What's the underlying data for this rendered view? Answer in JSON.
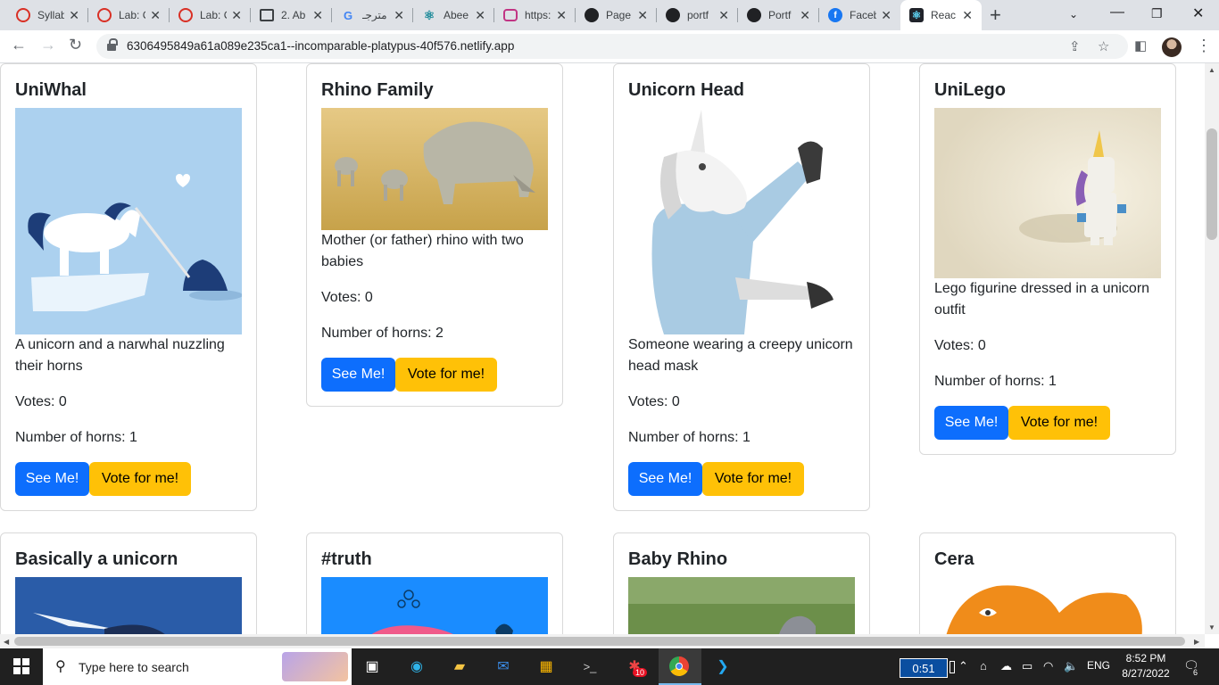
{
  "browser": {
    "tabs": [
      {
        "title": "Syllab",
        "icon": "red-ring-icon",
        "color": "#d93025"
      },
      {
        "title": "Lab: C",
        "icon": "red-ring-icon",
        "color": "#d93025"
      },
      {
        "title": "Lab: C",
        "icon": "red-ring-icon",
        "color": "#d93025"
      },
      {
        "title": "2. Ab",
        "icon": "book-icon",
        "color": "#3c4043"
      },
      {
        "title": "مترجـ",
        "icon": "google-g-icon",
        "color": "#4285f4"
      },
      {
        "title": "Abee",
        "icon": "react-atom-icon",
        "color": "#1c8a99"
      },
      {
        "title": "https:",
        "icon": "instagram-icon",
        "color": "#c13584"
      },
      {
        "title": "Page",
        "icon": "github-icon",
        "color": "#202124"
      },
      {
        "title": "portf",
        "icon": "github-icon",
        "color": "#202124"
      },
      {
        "title": "Portf",
        "icon": "github-icon",
        "color": "#202124"
      },
      {
        "title": "Faceb",
        "icon": "facebook-icon",
        "color": "#1877f2"
      },
      {
        "title": "Reac",
        "icon": "react-atom-icon",
        "color": "#61dafb",
        "active": true
      }
    ],
    "url": "6306495849a61a089e235ca1--incomparable-platypus-40f576.netlify.app"
  },
  "cards": [
    {
      "title": "UniWhal",
      "description": "A unicorn and a narwhal nuzzling their horns",
      "votes": "Votes: 0",
      "horns": "Number of horns: 1",
      "see_label": "See Me!",
      "vote_label": "Vote for me!"
    },
    {
      "title": "Rhino Family",
      "description": "Mother (or father) rhino with two babies",
      "votes": "Votes: 0",
      "horns": "Number of horns: 2",
      "see_label": "See Me!",
      "vote_label": "Vote for me!"
    },
    {
      "title": "Unicorn Head",
      "description": "Someone wearing a creepy unicorn head mask",
      "votes": "Votes: 0",
      "horns": "Number of horns: 1",
      "see_label": "See Me!",
      "vote_label": "Vote for me!"
    },
    {
      "title": "UniLego",
      "description": "Lego figurine dressed in a unicorn outfit",
      "votes": "Votes: 0",
      "horns": "Number of horns: 1",
      "see_label": "See Me!",
      "vote_label": "Vote for me!"
    },
    {
      "title": "Basically a unicorn"
    },
    {
      "title": "#truth"
    },
    {
      "title": "Baby Rhino"
    },
    {
      "title": "Cera"
    }
  ],
  "taskbar": {
    "search_placeholder": "Type here to search",
    "timer": "0:51",
    "language": "ENG",
    "time": "8:52 PM",
    "date": "8/27/2022",
    "notification_count": "6",
    "chrome_badge": "10"
  },
  "colors": {
    "primary": "#0d6efd",
    "warning": "#ffc107",
    "border": "#d9d9d9"
  }
}
